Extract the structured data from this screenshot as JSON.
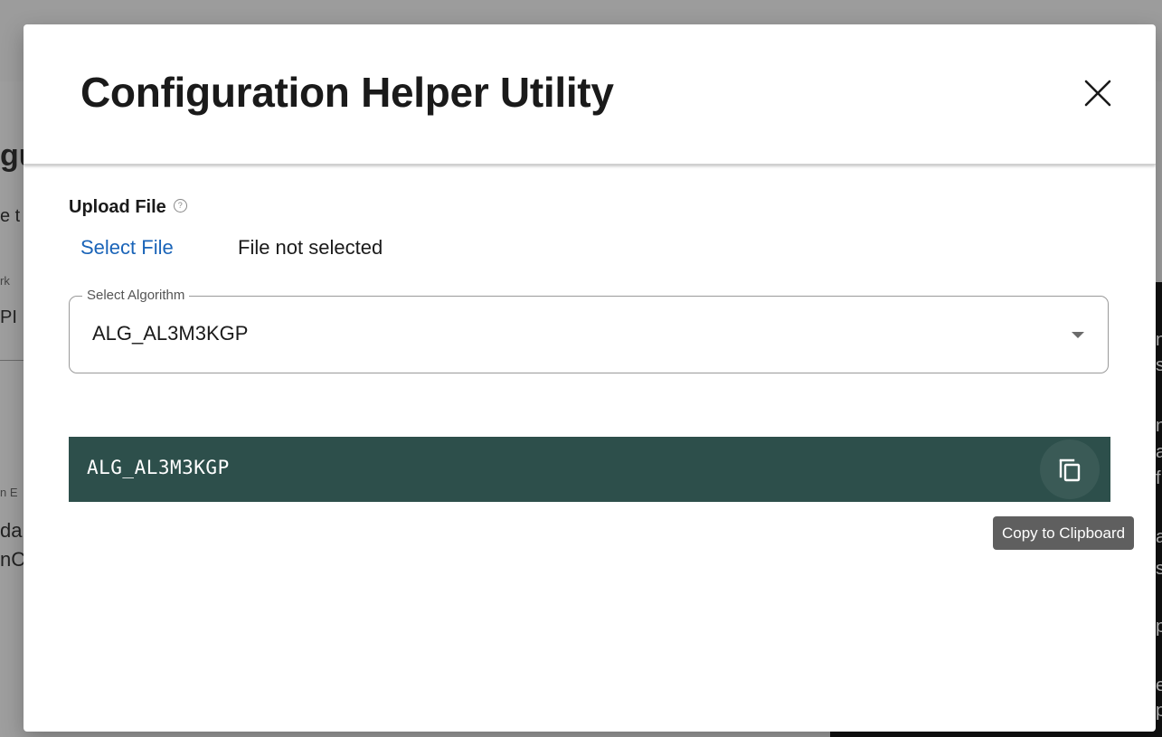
{
  "background": {
    "left_fragments": [
      "gu",
      "e t",
      "rk",
      "PI",
      "n E",
      "da",
      "nC"
    ],
    "right_fragments": [
      "n",
      "s",
      "n",
      "a",
      "f",
      "a",
      "s",
      "p",
      "e",
      "p"
    ]
  },
  "modal": {
    "title": "Configuration Helper Utility",
    "close_icon": "close-icon",
    "upload": {
      "label": "Upload File",
      "help_icon": "help-circle-icon",
      "help_glyph": "?",
      "select_link": "Select File",
      "status": "File not selected"
    },
    "algorithm": {
      "legend": "Select Algorithm",
      "value": "ALG_AL3M3KGP"
    },
    "output": {
      "value": "ALG_AL3M3KGP",
      "copy_icon": "copy-icon",
      "tooltip": "Copy to Clipboard"
    }
  },
  "colors": {
    "accent_link": "#1a64b8",
    "code_background": "#2d4f4b",
    "tooltip_background": "#5f5f5f"
  }
}
